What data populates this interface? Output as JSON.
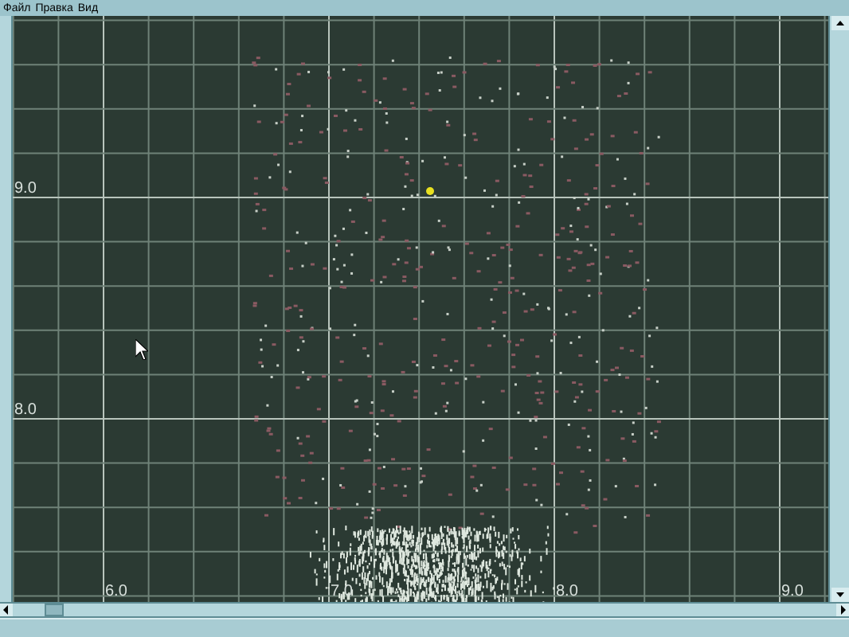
{
  "menu": [
    "Файл",
    "Правка",
    "Вид"
  ],
  "plot": {
    "y_labels": [
      "9.0",
      "8.0"
    ],
    "x_labels": [
      "6.0",
      "7.0",
      "8.0",
      "9.0"
    ]
  }
}
